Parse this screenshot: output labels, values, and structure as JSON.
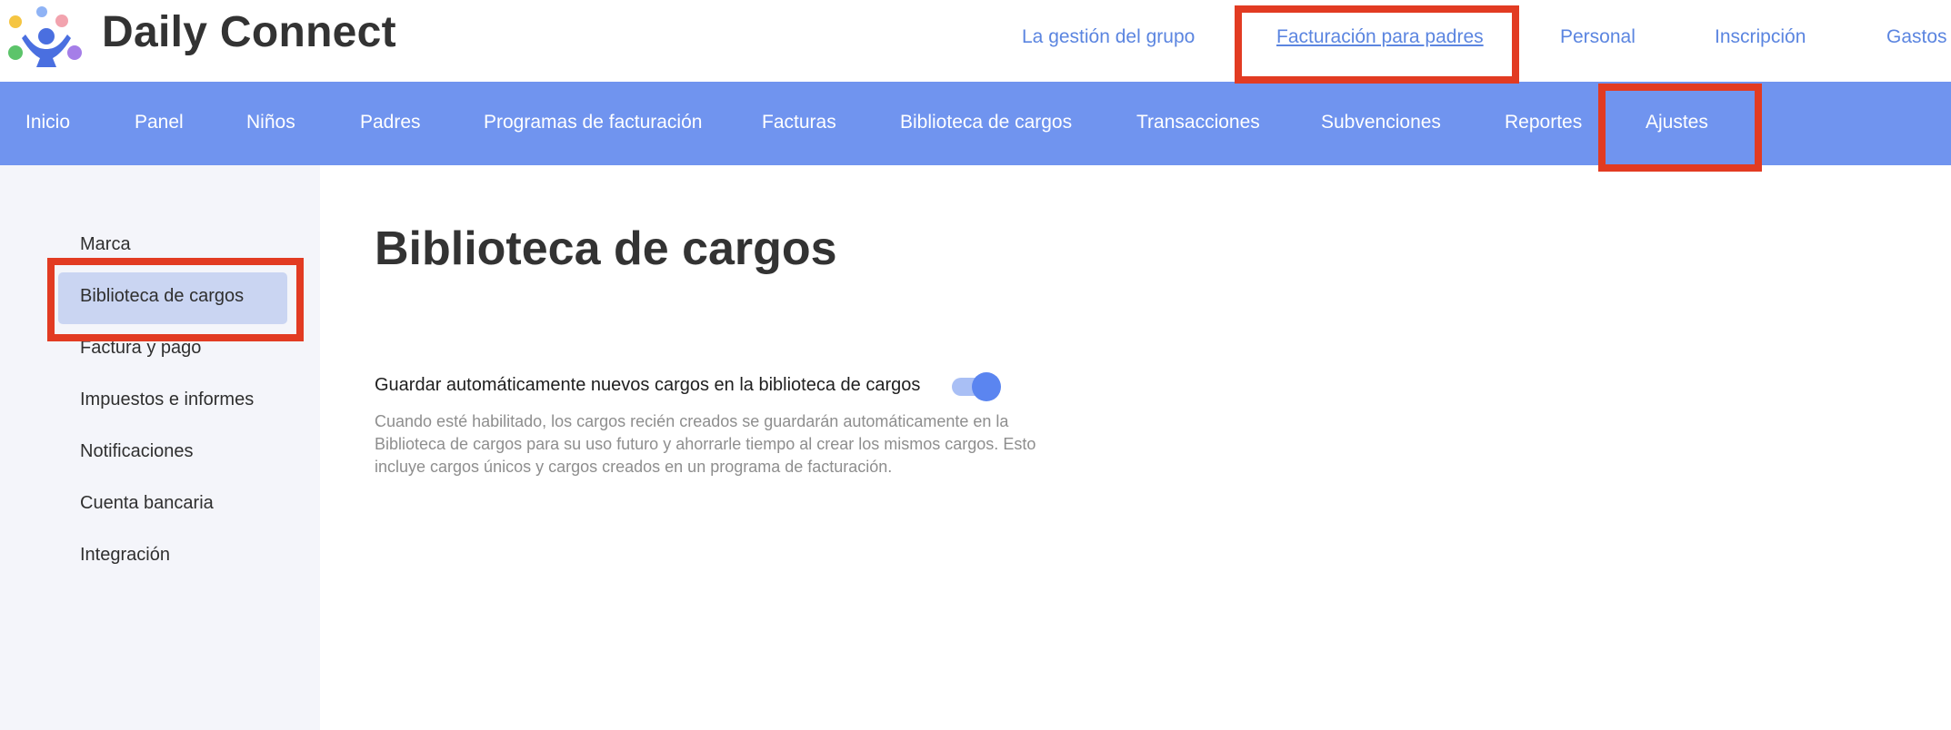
{
  "brand": {
    "name": "Daily Connect",
    "colors": {
      "primary_blue": "#7094ef",
      "link_blue": "#5b85e0",
      "highlight": "#e23b22"
    }
  },
  "top_nav": {
    "items": [
      {
        "label": "La gestión del grupo",
        "active": false
      },
      {
        "label": "Facturación para padres",
        "active": true
      },
      {
        "label": "Personal",
        "active": false
      },
      {
        "label": "Inscripción",
        "active": false
      },
      {
        "label": "Gastos",
        "active": false
      }
    ]
  },
  "main_nav": {
    "items": [
      {
        "label": "Inicio"
      },
      {
        "label": "Panel"
      },
      {
        "label": "Niños"
      },
      {
        "label": "Padres"
      },
      {
        "label": "Programas de facturación"
      },
      {
        "label": "Facturas"
      },
      {
        "label": "Biblioteca de cargos"
      },
      {
        "label": "Transacciones"
      },
      {
        "label": "Subvenciones"
      },
      {
        "label": "Reportes"
      },
      {
        "label": "Ajustes",
        "active": true
      }
    ]
  },
  "sidebar": {
    "items": [
      {
        "label": "Marca"
      },
      {
        "label": "Biblioteca de cargos",
        "active": true
      },
      {
        "label": "Factura y pago"
      },
      {
        "label": "Impuestos e informes"
      },
      {
        "label": "Notificaciones"
      },
      {
        "label": "Cuenta bancaria"
      },
      {
        "label": "Integración"
      }
    ]
  },
  "main": {
    "title": "Biblioteca de cargos",
    "setting": {
      "label": "Guardar automáticamente nuevos cargos en la biblioteca de cargos",
      "enabled": true,
      "description": "Cuando esté habilitado, los cargos recién creados se guardarán automáticamente en la Biblioteca de cargos para su uso futuro y ahorrarle tiempo al crear los mismos cargos. Esto incluye cargos únicos y cargos creados en un programa de facturación."
    }
  }
}
